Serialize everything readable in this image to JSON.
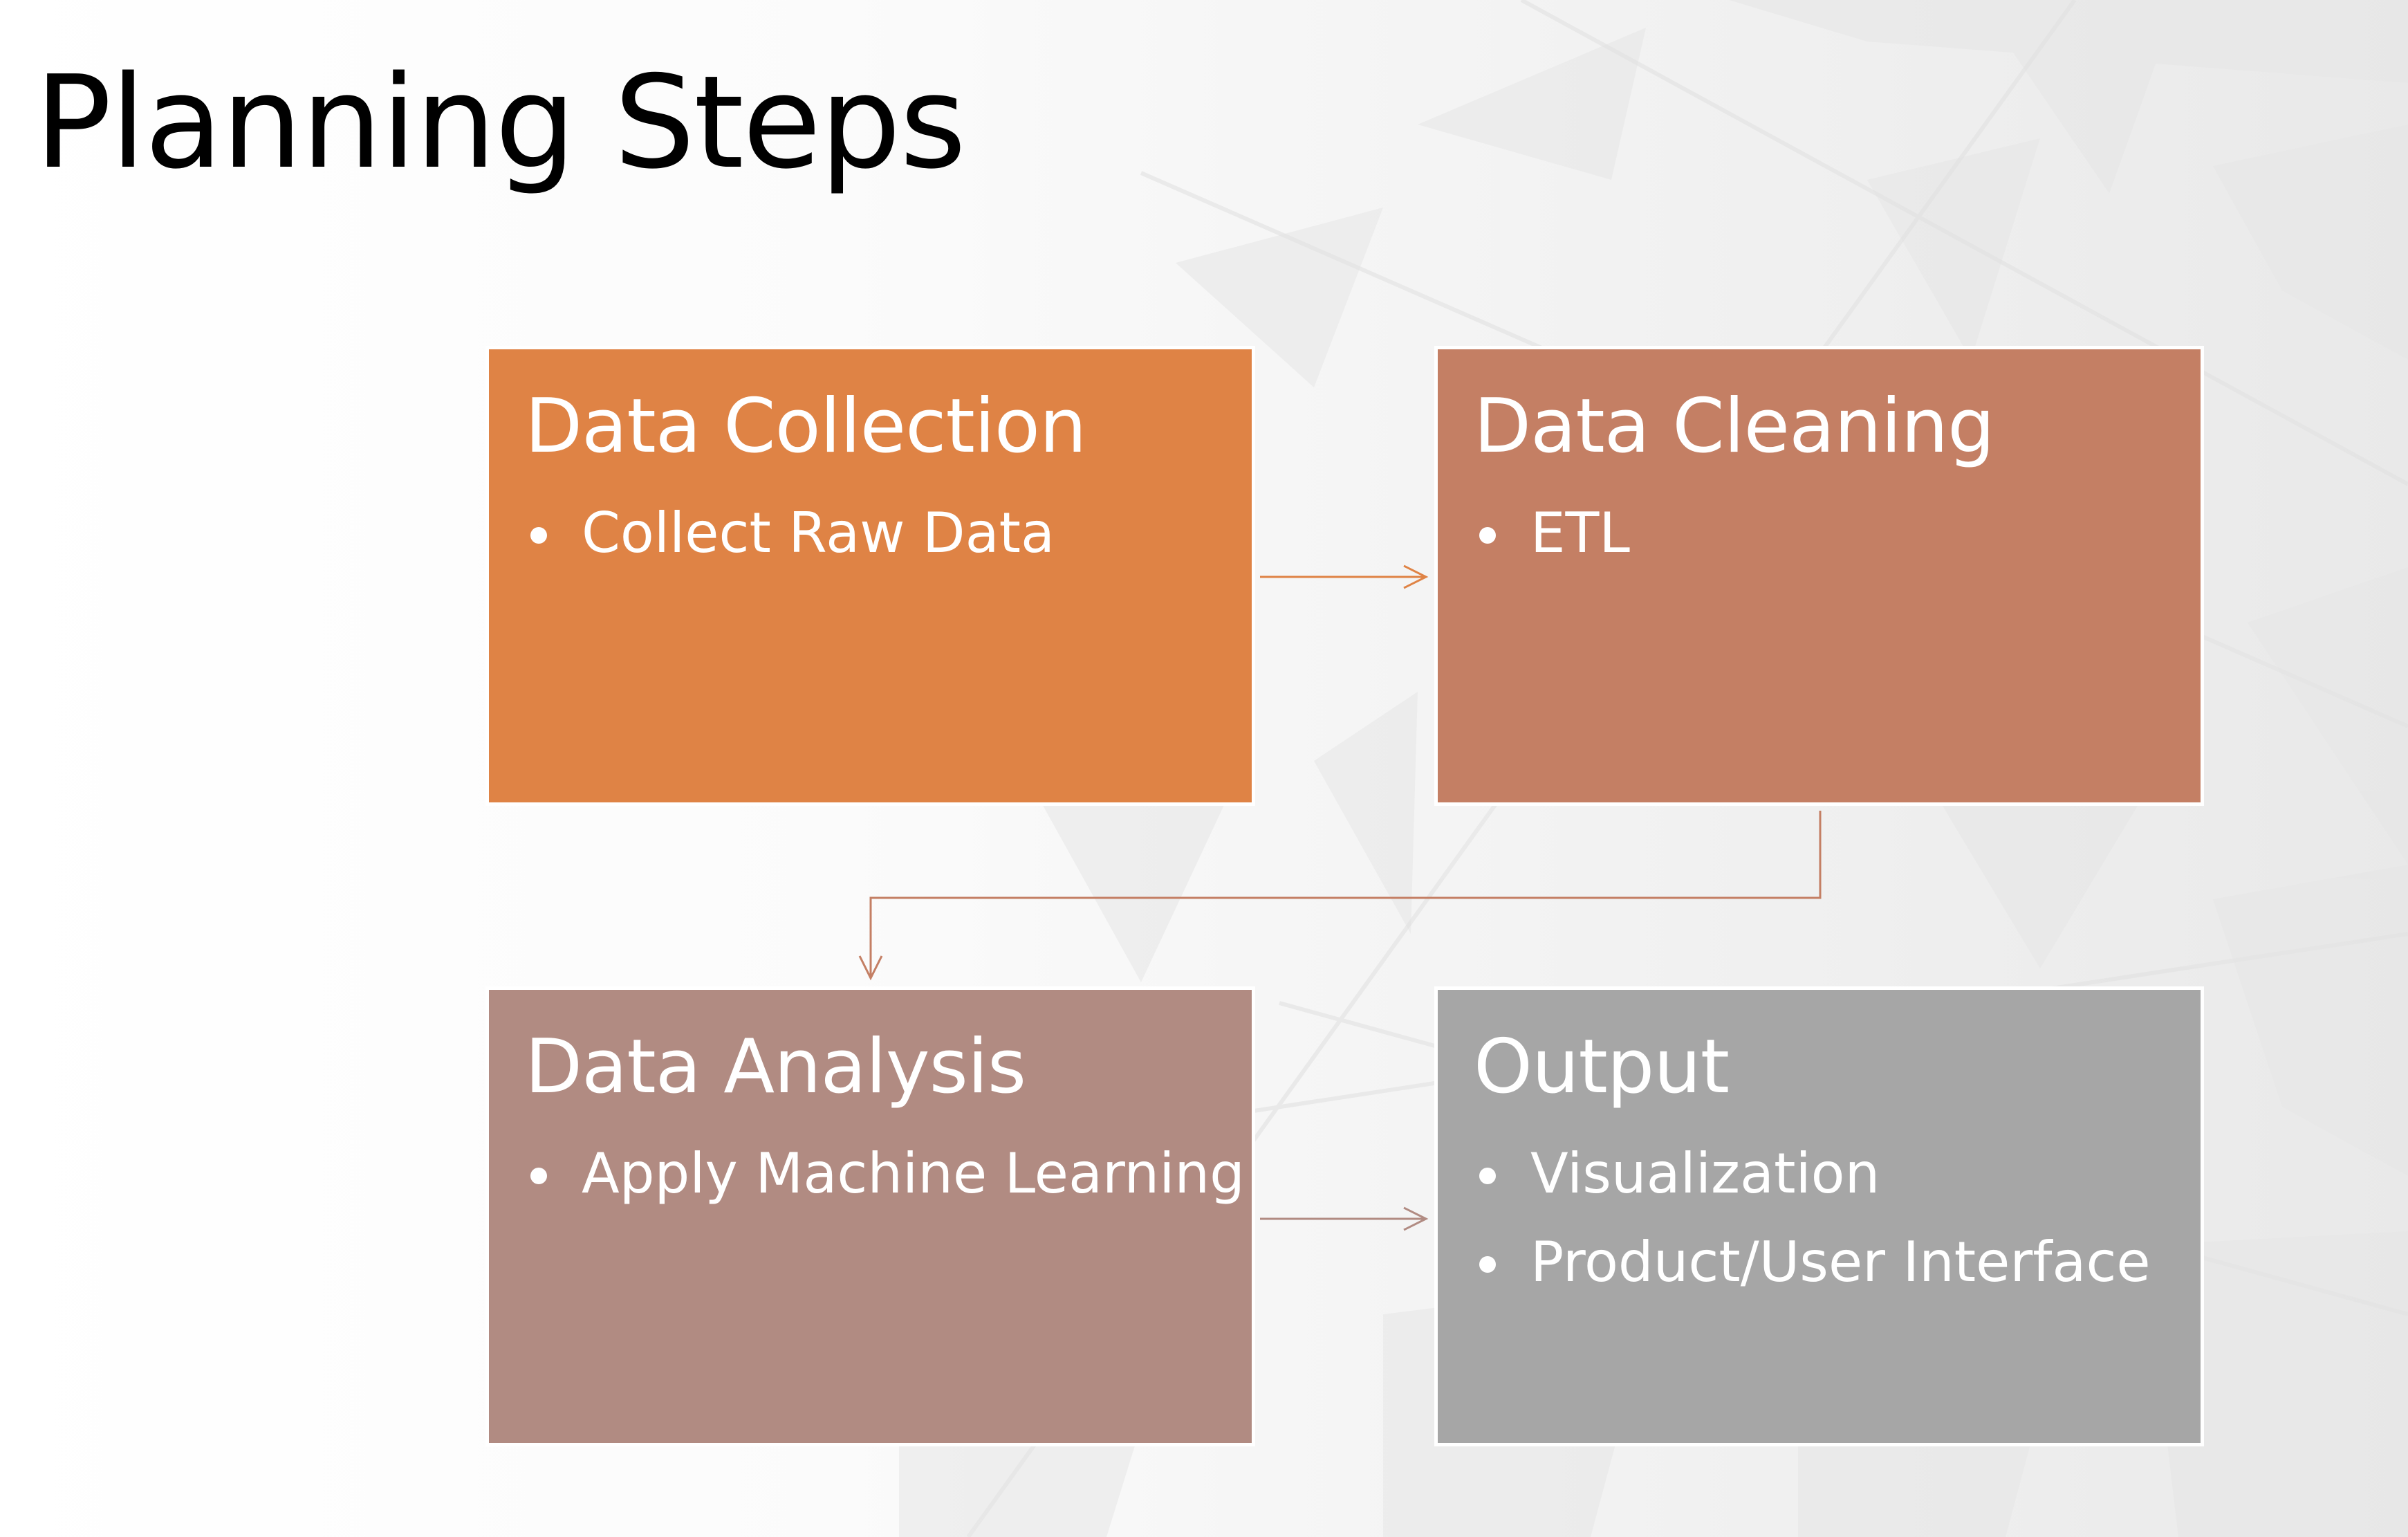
{
  "slide": {
    "title": "Planning Steps"
  },
  "steps": [
    {
      "title": "Data Collection",
      "bullets": [
        "Collect Raw Data"
      ],
      "color": "#df8345"
    },
    {
      "title": "Data Cleaning",
      "bullets": [
        "ETL"
      ],
      "color": "#c47f64"
    },
    {
      "title": "Data Analysis",
      "bullets": [
        "Apply Machine Learning"
      ],
      "color": "#b18b82"
    },
    {
      "title": "Output",
      "bullets": [
        "Visualization",
        "Product/User Interface"
      ],
      "color": "#a6a6a6"
    }
  ],
  "connector_colors": {
    "collection_to_cleaning": "#df8345",
    "cleaning_to_analysis": "#c47f64",
    "analysis_to_output": "#b18b82"
  }
}
